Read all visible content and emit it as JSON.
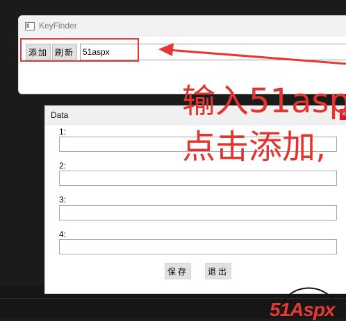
{
  "keyfinder": {
    "title": "KeyFinder",
    "add_label": "添加",
    "refresh_label": "刷新",
    "input_value": "51aspx"
  },
  "annotation": {
    "line1": "输入51asp",
    "line2": "点击添加,"
  },
  "data_dialog": {
    "title": "Data",
    "fields": [
      {
        "label": "1:"
      },
      {
        "label": "2:"
      },
      {
        "label": "3:"
      },
      {
        "label": "4:"
      }
    ],
    "save_label": "保存",
    "exit_label": "退出"
  },
  "watermark": {
    "brand": "51Aspx"
  },
  "colors": {
    "annotation_red": "#e3342f",
    "background": "#1c1c1c",
    "button_gray": "#e1e1e1"
  }
}
